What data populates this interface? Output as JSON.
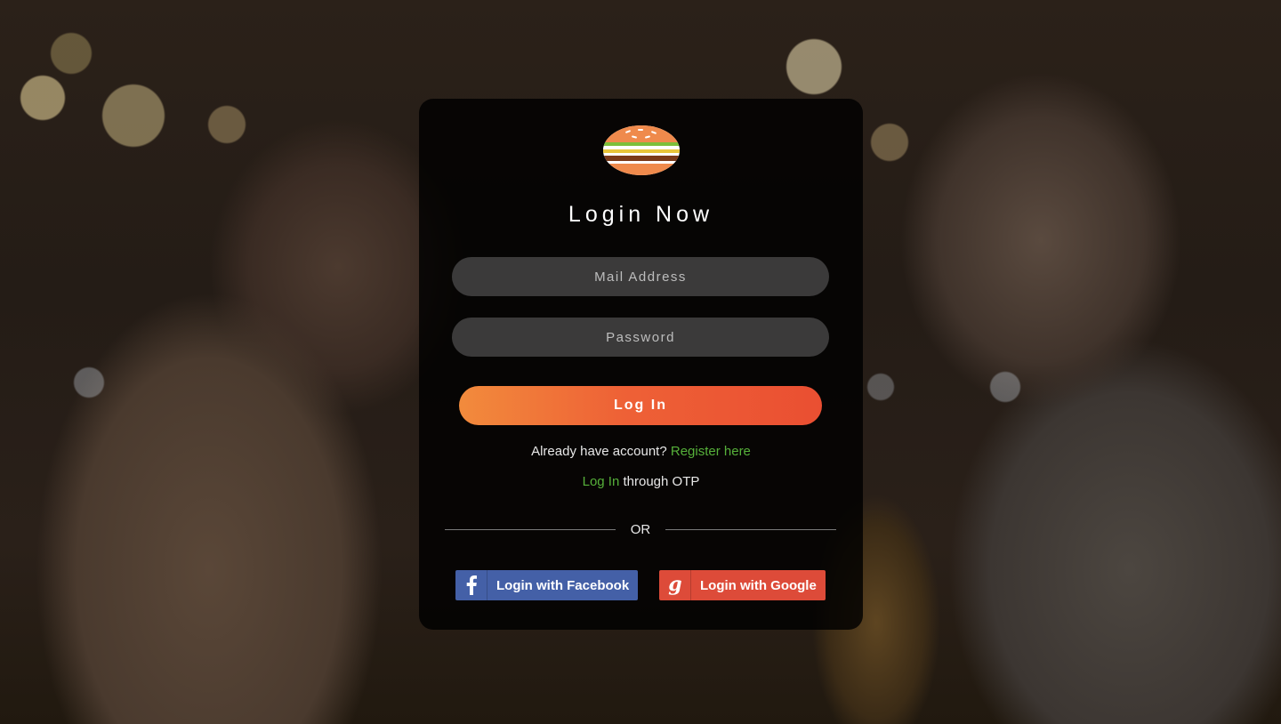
{
  "login": {
    "title": "Login Now",
    "email_placeholder": "Mail Address",
    "password_placeholder": "Password",
    "login_button": "Log In",
    "register_prompt": "Already have account? ",
    "register_link": "Register here",
    "otp_link": "Log In",
    "otp_suffix": " through OTP",
    "divider_text": "OR",
    "facebook_button": "Login with Facebook",
    "google_button": "Login with Google"
  },
  "icons": {
    "logo": "burger-icon",
    "facebook": "facebook-icon",
    "google": "google-icon"
  },
  "colors": {
    "accent_start": "#f28b3c",
    "accent_end": "#ea4f32",
    "link": "#56b03a",
    "facebook": "#4460a7",
    "google": "#dd4b39"
  }
}
